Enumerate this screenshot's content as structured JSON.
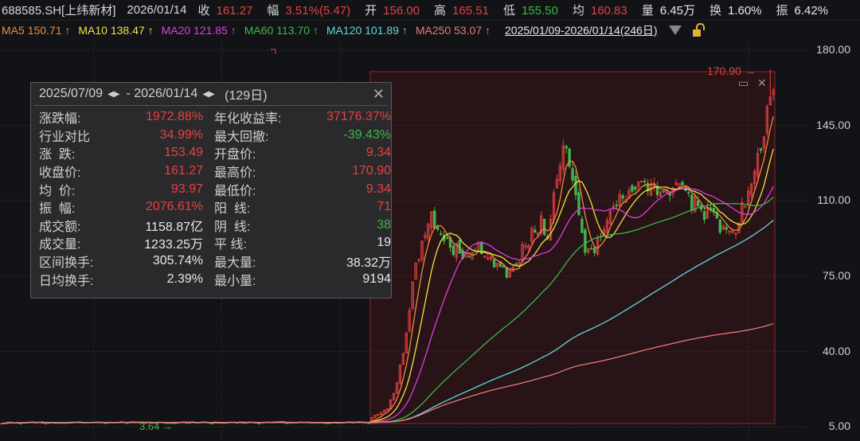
{
  "header": {
    "symbol": "688585.SH[上纬新材]",
    "date": "2026/01/14",
    "quote": [
      {
        "label": "收",
        "value": "161.27",
        "color": "red"
      },
      {
        "label": "幅",
        "value": "3.51%(5.47)",
        "color": "red"
      },
      {
        "label": "开",
        "value": "156.00",
        "color": "red"
      },
      {
        "label": "高",
        "value": "165.51",
        "color": "red"
      },
      {
        "label": "低",
        "value": "155.50",
        "color": "green"
      },
      {
        "label": "均",
        "value": "160.83",
        "color": "red"
      },
      {
        "label": "量",
        "value": "6.45万",
        "color": "white"
      },
      {
        "label": "换",
        "value": "1.60%",
        "color": "white"
      },
      {
        "label": "振",
        "value": "6.42%",
        "color": "white"
      }
    ]
  },
  "ma_legend": [
    {
      "label": "MA5 150.71 ↑",
      "color": "#f08a36"
    },
    {
      "label": "MA10 138.47 ↑",
      "color": "#f2e43a"
    },
    {
      "label": "MA20 121.85 ↑",
      "color": "#e03ce0"
    },
    {
      "label": "MA60 113.70 ↑",
      "color": "#3fb64a"
    },
    {
      "label": "MA120 101.89 ↑",
      "color": "#5fd8e0"
    },
    {
      "label": "MA250 53.07 ↑",
      "color": "#e87a78"
    }
  ],
  "range_selector": "2025/01/09-2026/01/14(246日)",
  "axis_labels": [
    "180.00",
    "145.00",
    "110.00",
    "75.00",
    "40.00",
    "5.00"
  ],
  "highlight": {
    "high_label": "170.90",
    "low_label": "3.64"
  },
  "panel": {
    "start": "2025/07/09",
    "sep": "-",
    "end": "2026/01/14",
    "days": "(129日)",
    "rows": [
      [
        {
          "label": "涨跌幅:",
          "value": "1972.88%",
          "color": "red"
        },
        {
          "label": "年化收益率:",
          "value": "37176.37%",
          "color": "red"
        }
      ],
      [
        {
          "label": "行业对比",
          "value": "34.99%",
          "color": "red"
        },
        {
          "label": "最大回撤:",
          "value": "-39.43%",
          "color": "green"
        }
      ],
      [
        {
          "label": "涨  跌:",
          "value": "153.49",
          "color": "red"
        },
        {
          "label": "开盘价:",
          "value": "9.34",
          "color": "red"
        }
      ],
      [
        {
          "label": "收盘价:",
          "value": "161.27",
          "color": "red"
        },
        {
          "label": "最高价:",
          "value": "170.90",
          "color": "red"
        }
      ],
      [
        {
          "label": "均  价:",
          "value": "93.97",
          "color": "red"
        },
        {
          "label": "最低价:",
          "value": "9.34",
          "color": "red"
        }
      ],
      [
        {
          "label": "振  幅:",
          "value": "2076.61%",
          "color": "red"
        },
        {
          "label": "阳  线:",
          "value": "71",
          "color": "red"
        }
      ],
      [
        {
          "label": "成交额:",
          "value": "1158.87亿",
          "color": "white"
        },
        {
          "label": "阴  线:",
          "value": "38",
          "color": "green"
        }
      ],
      [
        {
          "label": "成交量:",
          "value": "1233.25万",
          "color": "white"
        },
        {
          "label": "平 线:",
          "value": "19",
          "color": "white"
        }
      ],
      [
        {
          "label": "区间换手:",
          "value": "305.74%",
          "color": "white"
        },
        {
          "label": "最大量:",
          "value": "38.32万",
          "color": "white"
        }
      ],
      [
        {
          "label": "日均换手:",
          "value": "2.39%",
          "color": "white"
        },
        {
          "label": "最小量:",
          "value": "9194",
          "color": "white"
        }
      ]
    ]
  },
  "chart_data": {
    "type": "candlestick",
    "ylim": [
      5,
      180
    ],
    "yticks": [
      180,
      145,
      110,
      75,
      40,
      5
    ],
    "grid": true,
    "pre_range_days": 118,
    "pre_range_price": 7,
    "range_close_keypoints": [
      [
        0,
        9.3
      ],
      [
        5,
        14
      ],
      [
        8,
        25
      ],
      [
        10,
        40
      ],
      [
        12,
        60
      ],
      [
        14,
        80
      ],
      [
        17,
        95
      ],
      [
        19,
        105
      ],
      [
        20,
        100
      ],
      [
        22,
        92
      ],
      [
        25,
        88
      ],
      [
        30,
        85
      ],
      [
        35,
        88
      ],
      [
        40,
        80
      ],
      [
        43,
        76
      ],
      [
        46,
        82
      ],
      [
        50,
        92
      ],
      [
        54,
        100
      ],
      [
        56,
        95
      ],
      [
        58,
        115
      ],
      [
        60,
        130
      ],
      [
        62,
        135
      ],
      [
        64,
        120
      ],
      [
        66,
        100
      ],
      [
        68,
        88
      ],
      [
        70,
        85
      ],
      [
        72,
        90
      ],
      [
        75,
        100
      ],
      [
        78,
        108
      ],
      [
        82,
        112
      ],
      [
        86,
        115
      ],
      [
        90,
        118
      ],
      [
        94,
        112
      ],
      [
        98,
        116
      ],
      [
        102,
        110
      ],
      [
        106,
        105
      ],
      [
        108,
        106
      ],
      [
        112,
        95
      ],
      [
        114,
        93
      ],
      [
        117,
        100
      ],
      [
        120,
        115
      ],
      [
        123,
        128
      ],
      [
        125,
        140
      ],
      [
        127,
        160
      ],
      [
        128,
        161.27
      ]
    ],
    "range_high": 170.9,
    "up_color": "#e84040",
    "down_color": "#3fb64a"
  }
}
